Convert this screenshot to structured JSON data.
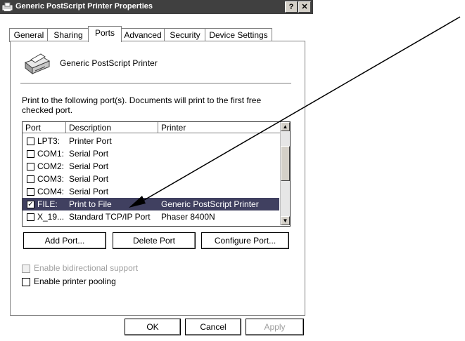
{
  "window": {
    "title": "Generic PostScript Printer Properties",
    "help_label": "?",
    "close_label": "✕"
  },
  "tabs": [
    {
      "label": "General"
    },
    {
      "label": "Sharing"
    },
    {
      "label": "Ports"
    },
    {
      "label": "Advanced"
    },
    {
      "label": "Security"
    },
    {
      "label": "Device Settings"
    }
  ],
  "active_tab": "Ports",
  "printer": {
    "name": "Generic PostScript Printer",
    "icon": "printer-icon"
  },
  "ports_description": "Print to the following port(s). Documents will print to the first free checked port.",
  "port_list": {
    "columns": [
      "Port",
      "Description",
      "Printer"
    ],
    "rows": [
      {
        "port": "LPT3:",
        "description": "Printer Port",
        "printer": "",
        "checked": false,
        "selected": false
      },
      {
        "port": "COM1:",
        "description": "Serial Port",
        "printer": "",
        "checked": false,
        "selected": false
      },
      {
        "port": "COM2:",
        "description": "Serial Port",
        "printer": "",
        "checked": false,
        "selected": false
      },
      {
        "port": "COM3:",
        "description": "Serial Port",
        "printer": "",
        "checked": false,
        "selected": false
      },
      {
        "port": "COM4:",
        "description": "Serial Port",
        "printer": "",
        "checked": false,
        "selected": false
      },
      {
        "port": "FILE:",
        "description": "Print to File",
        "printer": "Generic PostScript Printer",
        "checked": true,
        "selected": true
      },
      {
        "port": "X_19...",
        "description": "Standard TCP/IP Port",
        "printer": "Phaser 8400N",
        "checked": false,
        "selected": false
      }
    ]
  },
  "port_buttons": {
    "add": "Add Port...",
    "delete": "Delete Port",
    "configure": "Configure Port..."
  },
  "options": {
    "bidirectional_label": "Enable bidirectional support",
    "bidirectional_checked": false,
    "bidirectional_enabled": false,
    "pooling_label": "Enable printer pooling",
    "pooling_checked": false
  },
  "dialog_buttons": {
    "ok": "OK",
    "cancel": "Cancel",
    "apply": "Apply"
  },
  "colors": {
    "titlebar": "#404040",
    "selection": "#404060"
  }
}
